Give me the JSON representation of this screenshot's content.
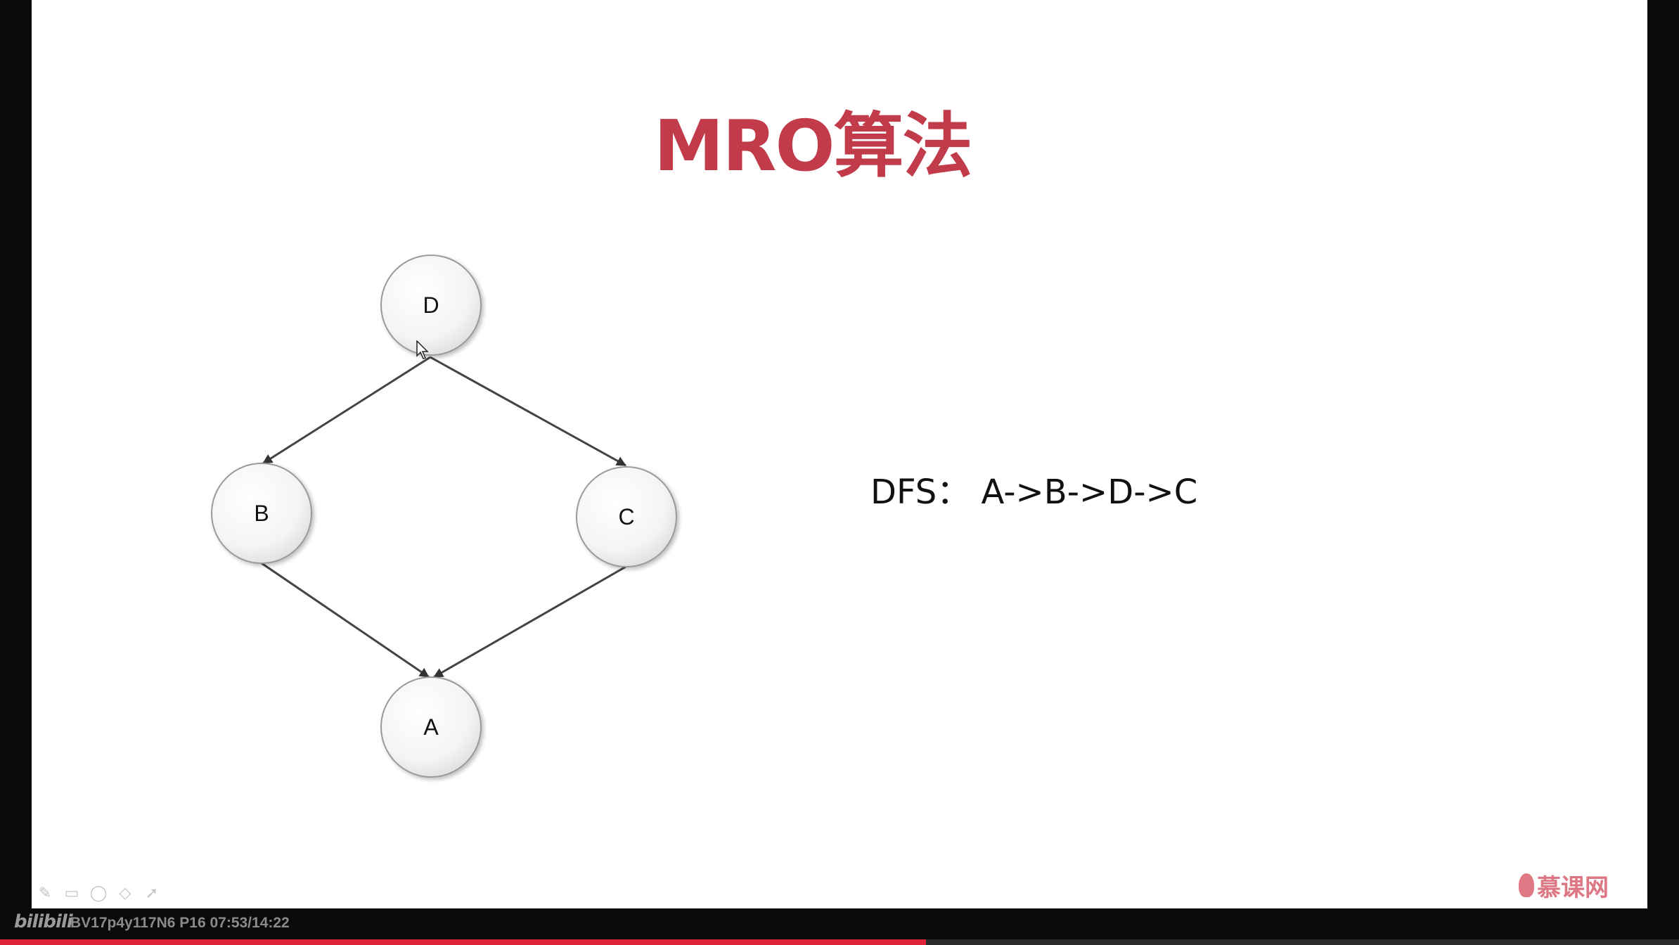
{
  "slide": {
    "title": "MRO算法",
    "title_color": "#c23b4b",
    "formula": "DFS：  A->B->D->C"
  },
  "diagram": {
    "nodes": [
      {
        "id": "D",
        "label": "D"
      },
      {
        "id": "B",
        "label": "B"
      },
      {
        "id": "C",
        "label": "C"
      },
      {
        "id": "A",
        "label": "A"
      }
    ],
    "edges": [
      {
        "from": "D",
        "to": "B"
      },
      {
        "from": "D",
        "to": "C"
      },
      {
        "from": "B",
        "to": "A"
      },
      {
        "from": "C",
        "to": "A"
      }
    ]
  },
  "toolbar": {
    "icons": [
      "pencil-icon",
      "rectangle-icon",
      "ellipse-icon",
      "eraser-icon",
      "pointer-icon"
    ]
  },
  "watermark": {
    "text": "慕课网",
    "color": "#d9606f"
  },
  "video": {
    "logo": "bilibili",
    "info": "BV17p4y117N6 P16 07:53/14:22",
    "progress": 0.5514,
    "accent": "#e0223a"
  }
}
